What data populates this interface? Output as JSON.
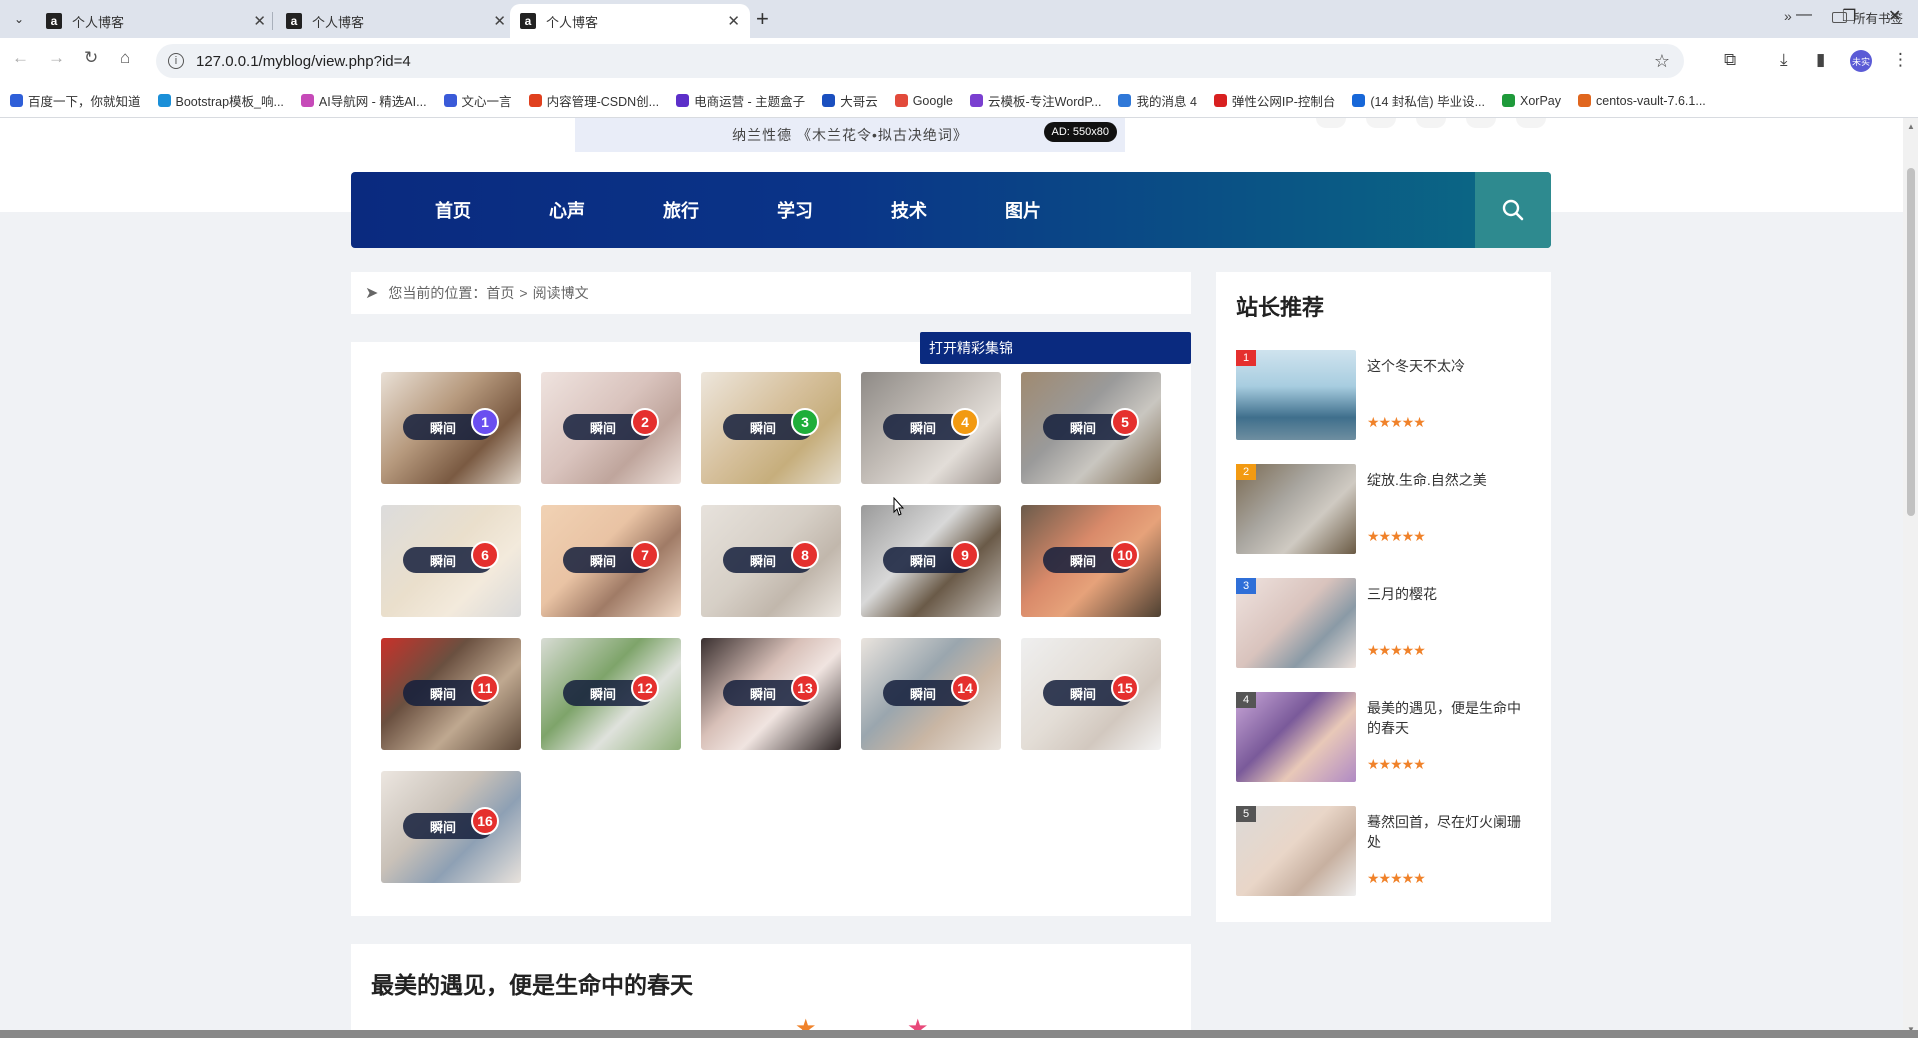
{
  "browser": {
    "tabs": [
      {
        "title": "个人博客",
        "favicon": "a"
      },
      {
        "title": "个人博客",
        "favicon": "a"
      },
      {
        "title": "个人博客",
        "favicon": "a"
      }
    ],
    "new_tab": "+",
    "url": "127.0.0.1/myblog/view.php?id=4",
    "bookmarks": [
      {
        "label": "百度一下，你就知道",
        "color": "#2f5fd8"
      },
      {
        "label": "Bootstrap模板_响...",
        "color": "#1a8fd8"
      },
      {
        "label": "AI导航网 - 精选AI...",
        "color": "#c64ab8"
      },
      {
        "label": "文心一言",
        "color": "#3a5ad8"
      },
      {
        "label": "内容管理-CSDN创...",
        "color": "#e0401e"
      },
      {
        "label": "电商运营 - 主题盒子",
        "color": "#5c2fc9"
      },
      {
        "label": "大哥云",
        "color": "#1a4fbf"
      },
      {
        "label": "Google",
        "color": "#e24a3b"
      },
      {
        "label": "云模板-专注WordP...",
        "color": "#7a3fd0"
      },
      {
        "label": "我的消息 4",
        "color": "#2f78d8"
      },
      {
        "label": "弹性公网IP-控制台",
        "color": "#d82020"
      },
      {
        "label": "(14 封私信) 毕业设...",
        "color": "#1767d8"
      },
      {
        "label": "XorPay",
        "color": "#1e9a3a"
      },
      {
        "label": "centos-vault-7.6.1...",
        "color": "#e0661e"
      }
    ],
    "more_bookmarks": "»",
    "all_bookmarks": "所有书签",
    "profile_label": "未实"
  },
  "ad": {
    "text": "纳兰性德 《木兰花令•拟古决绝词》",
    "tag": "AD: 550x80"
  },
  "nav": {
    "items": [
      "首页",
      "心声",
      "旅行",
      "学习",
      "技术",
      "图片"
    ],
    "search_icon": "search-icon"
  },
  "breadcrumb": {
    "prefix": "您当前的位置：",
    "home": "首页",
    "separator": ">",
    "current": "阅读博文"
  },
  "gallery": {
    "open_button": "打开精彩集锦",
    "pill_label": "瞬间",
    "items": [
      {
        "num": "1",
        "badge": "#6a4ff0",
        "bg": "linear-gradient(135deg,#e9e0d6,#b79a7e 40%,#7a5a42 70%,#ddd2c6)"
      },
      {
        "num": "2",
        "badge": "#e5302e",
        "bg": "linear-gradient(135deg,#efe3df,#d9c3bd 45%,#bfa59c 70%,#eee2dc)"
      },
      {
        "num": "3",
        "badge": "#1fae3a",
        "bg": "linear-gradient(135deg,#ede6dc,#d6c09c 45%,#c6ae7c 70%,#e4dccc)"
      },
      {
        "num": "4",
        "badge": "#f29a12",
        "bg": "linear-gradient(135deg,#8e8a86,#c4beb8 45%,#e2ddd8 70%,#9a918a)"
      },
      {
        "num": "5",
        "badge": "#e5302e",
        "bg": "linear-gradient(135deg,#a08a70,#9a9a9a 40%,#c9c6c0 65%,#7d6a50)"
      },
      {
        "num": "6",
        "badge": "#e5302e",
        "bg": "linear-gradient(135deg,#dcdcdc,#eadfcc 45%,#f3eadc 70%,#d9d9d9)"
      },
      {
        "num": "7",
        "badge": "#e5302e",
        "bg": "linear-gradient(135deg,#f1d2b4,#e9c3a4 40%,#a07b66 65%,#f0d9c6)"
      },
      {
        "num": "8",
        "badge": "#e5302e",
        "bg": "linear-gradient(135deg,#e7e2dc,#d6cfc6 45%,#c1b7ac 70%,#ece7e1)"
      },
      {
        "num": "9",
        "badge": "#e5302e",
        "bg": "linear-gradient(135deg,#9a9a9a,#d8d8d8 40%,#6a5a48 65%,#c7c2bc)"
      },
      {
        "num": "10",
        "badge": "#e5302e",
        "bg": "linear-gradient(135deg,#6b5b4b,#d98a6a 40%,#e6a27a 60%,#4e4032)"
      },
      {
        "num": "11",
        "badge": "#e5302e",
        "bg": "linear-gradient(135deg,#c8312a,#6a5040 35%,#bfa890 65%,#5e4a3a)"
      },
      {
        "num": "12",
        "badge": "#e5302e",
        "bg": "linear-gradient(135deg,#d8dcd4,#7ea46a 40%,#dfe2dc 65%,#8fb07a)"
      },
      {
        "num": "13",
        "badge": "#e5302e",
        "bg": "linear-gradient(135deg,#3a3030,#d8c0b8 40%,#f0e4e0 60%,#2e2626)"
      },
      {
        "num": "14",
        "badge": "#e5302e",
        "bg": "linear-gradient(135deg,#eae4de,#9aa6ae 40%,#c9b6a4 65%,#e9e3dd)"
      },
      {
        "num": "15",
        "badge": "#e5302e",
        "bg": "linear-gradient(135deg,#efefef,#e3ddd6 45%,#d2c8bf 70%,#f3f3f3)"
      },
      {
        "num": "16",
        "badge": "#e5302e",
        "bg": "linear-gradient(135deg,#ece6e0,#c9c1b8 40%,#8ea0b4 65%,#e8e2dc)"
      }
    ]
  },
  "sidebar": {
    "title": "站长推荐",
    "items": [
      {
        "rank": "1",
        "rank_color": "#e5302e",
        "title": "这个冬天不太冷",
        "stars": "★★★★★",
        "bg": "linear-gradient(180deg,#cfe3ee,#a8cde0 40%,#3f6f8c 75%,#6e8ea0)"
      },
      {
        "rank": "2",
        "rank_color": "#f29a12",
        "title": "绽放.生命.自然之美",
        "stars": "★★★★★",
        "bg": "linear-gradient(135deg,#7a6a52,#a9a6a0 40%,#cfcac2 65%,#6a5a44)"
      },
      {
        "rank": "3",
        "rank_color": "#2f6fd8",
        "title": "三月的樱花",
        "stars": "★★★★★",
        "bg": "linear-gradient(135deg,#efe3df,#d9c3bd 45%,#8a9aa6 70%,#eee2dc)"
      },
      {
        "rank": "4",
        "rank_color": "#555555",
        "title": "最美的遇见，便是生命中的春天",
        "stars": "★★★★★",
        "bg": "linear-gradient(135deg,#c9a7d8,#7a5a9a 40%,#e8c8b8 65%,#b08ac4)"
      },
      {
        "rank": "5",
        "rank_color": "#555555",
        "title": "蓦然回首，尽在灯火阑珊处",
        "stars": "★★★★★",
        "bg": "linear-gradient(135deg,#dcdad8,#e9d6c8 45%,#c7b0a0 70%,#eeeeee)"
      }
    ]
  },
  "article": {
    "title": "最美的遇见，便是生命中的春天"
  }
}
